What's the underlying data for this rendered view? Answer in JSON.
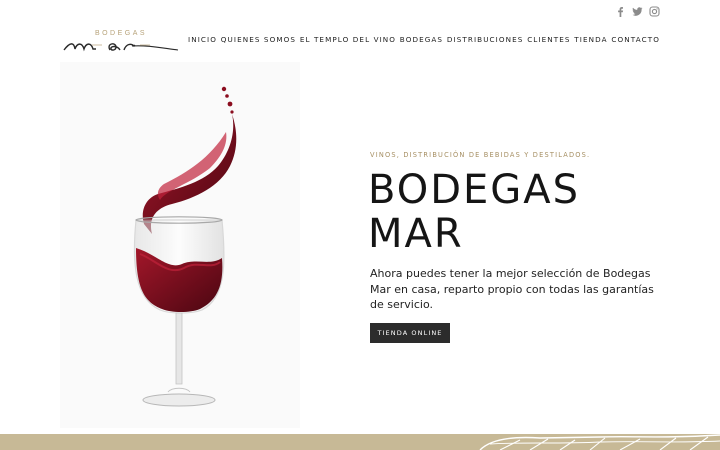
{
  "social": {
    "icons": [
      "facebook-icon",
      "twitter-icon",
      "instagram-icon"
    ],
    "color": "#8b8b8b"
  },
  "logo": {
    "top_text": "BODEGAS",
    "script_text": "mar"
  },
  "nav": {
    "items": [
      "INICIO",
      "QUIENES SOMOS",
      "EL TEMPLO DEL VINO",
      "BODEGAS",
      "DISTRIBUCIONES",
      "CLIENTES",
      "TIENDA",
      "CONTACTO"
    ]
  },
  "hero": {
    "tagline": "VINOS,  DISTRIBUCIÓN DE BEBIDAS Y DESTILADOS.",
    "title_line1": "BODEGAS",
    "title_line2": "MAR",
    "description": "Ahora puedes tener la mejor selección de Bodegas Mar en casa, reparto propio con todas las garantías de servicio.",
    "button_label": "TIENDA ONLINE",
    "image_icon": "wine-glass-splash-icon"
  },
  "colors": {
    "accent_gold": "#b7a37a",
    "band": "#c7b996",
    "wine": "#7a0f1c",
    "button": "#2c2c2c"
  }
}
